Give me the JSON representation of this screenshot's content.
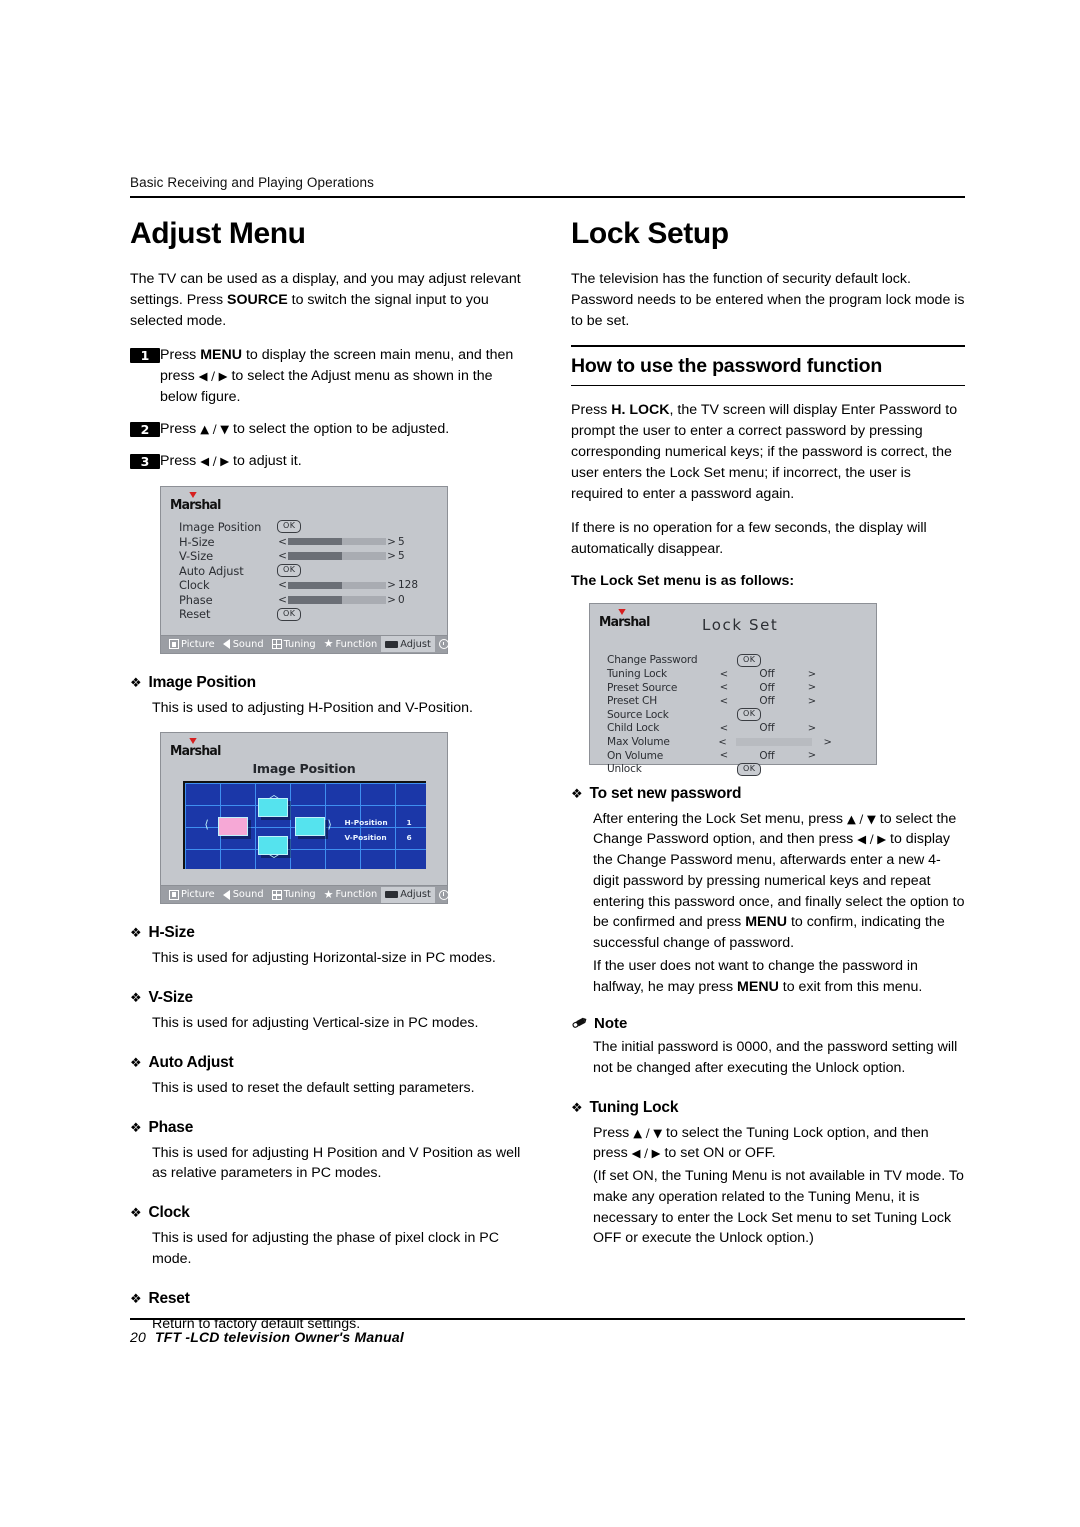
{
  "header": {
    "running_head": "Basic Receiving and Playing Operations"
  },
  "footer": {
    "page_number": "20",
    "manual_title": "TFT -LCD  television  Owner's Manual"
  },
  "left_column": {
    "title": "Adjust Menu",
    "intro_a": "The TV can be used as a display, and you may adjust relevant settings.  Press ",
    "intro_b": "SOURCE",
    "intro_c": " to switch the signal input to you selected mode.",
    "steps": [
      {
        "num": "1",
        "a": "Press ",
        "bold": "MENU",
        "b": " to display the screen main menu, and then press ",
        "arrows": "◀ / ▶",
        "c": "  to select the Adjust menu as shown in the below figure."
      },
      {
        "num": "2",
        "a": "Press ",
        "bold": "",
        "b": "",
        "arrows": "▲ / ▼",
        "c": "  to select the option to be adjusted."
      },
      {
        "num": "3",
        "a": "Press ",
        "bold": "",
        "b": "",
        "arrows": "◀ / ▶",
        "c": "  to adjust it."
      }
    ],
    "sections": [
      {
        "mark": "❖",
        "heading": "Image Position",
        "body": "This is used to adjusting H-Position and V-Position."
      },
      {
        "mark": "❖",
        "heading": "H-Size",
        "body": "This is used for adjusting Horizontal-size in PC modes."
      },
      {
        "mark": "❖",
        "heading": "V-Size",
        "body": "This is used for adjusting Vertical-size in PC modes."
      },
      {
        "mark": "❖",
        "heading": "Auto Adjust",
        "body": "This is used to reset the default setting parameters."
      },
      {
        "mark": "❖",
        "heading": "Phase",
        "body": "This is used for adjusting H Position and V Position as well as relative parameters in PC modes."
      },
      {
        "mark": "❖",
        "heading": "Clock",
        "body": "This is used for adjusting the phase of pixel clock in PC mode."
      },
      {
        "mark": "❖",
        "heading": "Reset",
        "body": "Return to  factory default settings."
      }
    ]
  },
  "right_column": {
    "title": "Lock Setup",
    "intro": "The television has the function of security default lock. Password needs to be entered when the program lock mode is to be set.",
    "section_heading": "How to use the password function",
    "para1_a": "Press ",
    "para1_b": "H. LOCK",
    "para1_c": ", the TV screen will display Enter Password to prompt the user to enter a correct password by pressing corresponding numerical keys; if the password is correct, the user enters the Lock Set menu; if incorrect, the user is required to enter a password again.",
    "para2": "If there is no operation for a few seconds, the display will automatically disappear.",
    "lock_set_intro": "The Lock Set menu is as follows:",
    "new_password": {
      "mark": "❖",
      "heading": "To set new password",
      "p1_a": "After entering the Lock Set menu, press ",
      "p1_arrows1": "▲ / ▼",
      "p1_b": "  to select the Change Password option, and then press  ",
      "p1_arrows2": "◀ / ▶",
      "p1_c": "  to display the Change Password menu, afterwards enter a new 4-digit password by pressing numerical keys and repeat entering this password once, and finally select the option to be confirmed and press ",
      "p1_bold": "MENU",
      "p1_d": " to confirm, indicating the successful change of password.",
      "p2_a": "If the user does not want to change the password in halfway, he may press ",
      "p2_bold": "MENU",
      "p2_b": " to exit from this menu."
    },
    "note": {
      "icon": "pencil-icon",
      "heading": "Note",
      "body": "The initial password is 0000, and the password setting will not be changed after executing the Unlock option."
    },
    "tuning_lock": {
      "mark": "❖",
      "heading": "Tuning Lock",
      "p1_a": "Press ",
      "p1_arrows1": "▲ / ▼",
      "p1_b": "  to select the Tuning Lock option, and then press  ",
      "p1_arrows2": "◀ / ▶",
      "p1_c": "  to set ON or OFF.",
      "p2": "(If set ON, the Tuning Menu is not available in TV mode. To make any operation related to the Tuning Menu, it is necessary to enter the Lock Set menu to set Tuning Lock OFF or execute the Unlock option.)"
    }
  },
  "osd_adjust": {
    "brand": "Marshal",
    "rows": [
      {
        "label": "Image Position",
        "type": "ok",
        "ok": "OK",
        "value": "",
        "fill": 0
      },
      {
        "label": "H-Size",
        "type": "slider",
        "ok": "",
        "value": "5",
        "fill": 55
      },
      {
        "label": "V-Size",
        "type": "slider",
        "ok": "",
        "value": "5",
        "fill": 55
      },
      {
        "label": "Auto Adjust",
        "type": "ok",
        "ok": "OK",
        "value": "",
        "fill": 0
      },
      {
        "label": "Clock",
        "type": "slider",
        "ok": "",
        "value": "128",
        "fill": 55
      },
      {
        "label": "Phase",
        "type": "slider",
        "ok": "",
        "value": "0",
        "fill": 55
      },
      {
        "label": "Reset",
        "type": "ok",
        "ok": "OK",
        "value": "",
        "fill": 0
      }
    ],
    "left_arrow": "<",
    "right_arrow": ">",
    "tabs": [
      {
        "icon": "picture-icon",
        "label": "Picture",
        "active": false
      },
      {
        "icon": "sound-icon",
        "label": "Sound",
        "active": false
      },
      {
        "icon": "tuning-icon",
        "label": "Tuning",
        "active": false
      },
      {
        "icon": "star-icon",
        "label": "Function",
        "active": false
      },
      {
        "icon": "adjust-icon",
        "label": "Adjust",
        "active": true
      },
      {
        "icon": "timer-icon",
        "label": "Timer",
        "active": false
      }
    ]
  },
  "osd_image_position": {
    "brand": "Marshal",
    "title": "Image Position",
    "readout": [
      {
        "label": "H-Position",
        "value": "1"
      },
      {
        "label": "V-Position",
        "value": "6"
      }
    ],
    "carets": {
      "up": "⌃",
      "down": "⌄",
      "left": "❮",
      "right": "❯"
    },
    "tabs": [
      {
        "icon": "picture-icon",
        "label": "Picture",
        "active": false
      },
      {
        "icon": "sound-icon",
        "label": "Sound",
        "active": false
      },
      {
        "icon": "tuning-icon",
        "label": "Tuning",
        "active": false
      },
      {
        "icon": "star-icon",
        "label": "Function",
        "active": false
      },
      {
        "icon": "adjust-icon",
        "label": "Adjust",
        "active": true
      },
      {
        "icon": "timer-icon",
        "label": "Timer",
        "active": false
      }
    ]
  },
  "osd_lock_set": {
    "brand": "Marshal",
    "title": "Lock Set",
    "rows": [
      {
        "label": "Change Password",
        "type": "ok",
        "ok": "OK",
        "left": "",
        "value": "",
        "right": ""
      },
      {
        "label": "Tuning Lock",
        "type": "value",
        "ok": "",
        "left": "<",
        "value": "Off",
        "right": ">"
      },
      {
        "label": "Preset Source",
        "type": "value",
        "ok": "",
        "left": "<",
        "value": "Off",
        "right": ">"
      },
      {
        "label": "Preset CH",
        "type": "value",
        "ok": "",
        "left": "<",
        "value": "Off",
        "right": ">"
      },
      {
        "label": "Source Lock",
        "type": "ok",
        "ok": "OK",
        "left": "",
        "value": "",
        "right": ""
      },
      {
        "label": "Child Lock",
        "type": "value",
        "ok": "",
        "left": "<",
        "value": "Off",
        "right": ">"
      },
      {
        "label": "Max Volume",
        "type": "bar",
        "ok": "",
        "left": "<",
        "value": "",
        "right": ">"
      },
      {
        "label": "On Volume",
        "type": "value",
        "ok": "",
        "left": "<",
        "value": "Off",
        "right": ">"
      },
      {
        "label": "Unlock",
        "type": "ok",
        "ok": "OK",
        "left": "",
        "value": "",
        "right": ""
      }
    ]
  },
  "colors": {
    "osd_background": "#c4c7cc",
    "osd_tabbar": "#9b9ea4",
    "brand_accent": "#d61f1f",
    "figure_blue": "#1b37a8",
    "figure_grid": "#3f8ff0",
    "pad_cyan": "#55e3ee",
    "pad_pink": "#f6a8d6"
  }
}
